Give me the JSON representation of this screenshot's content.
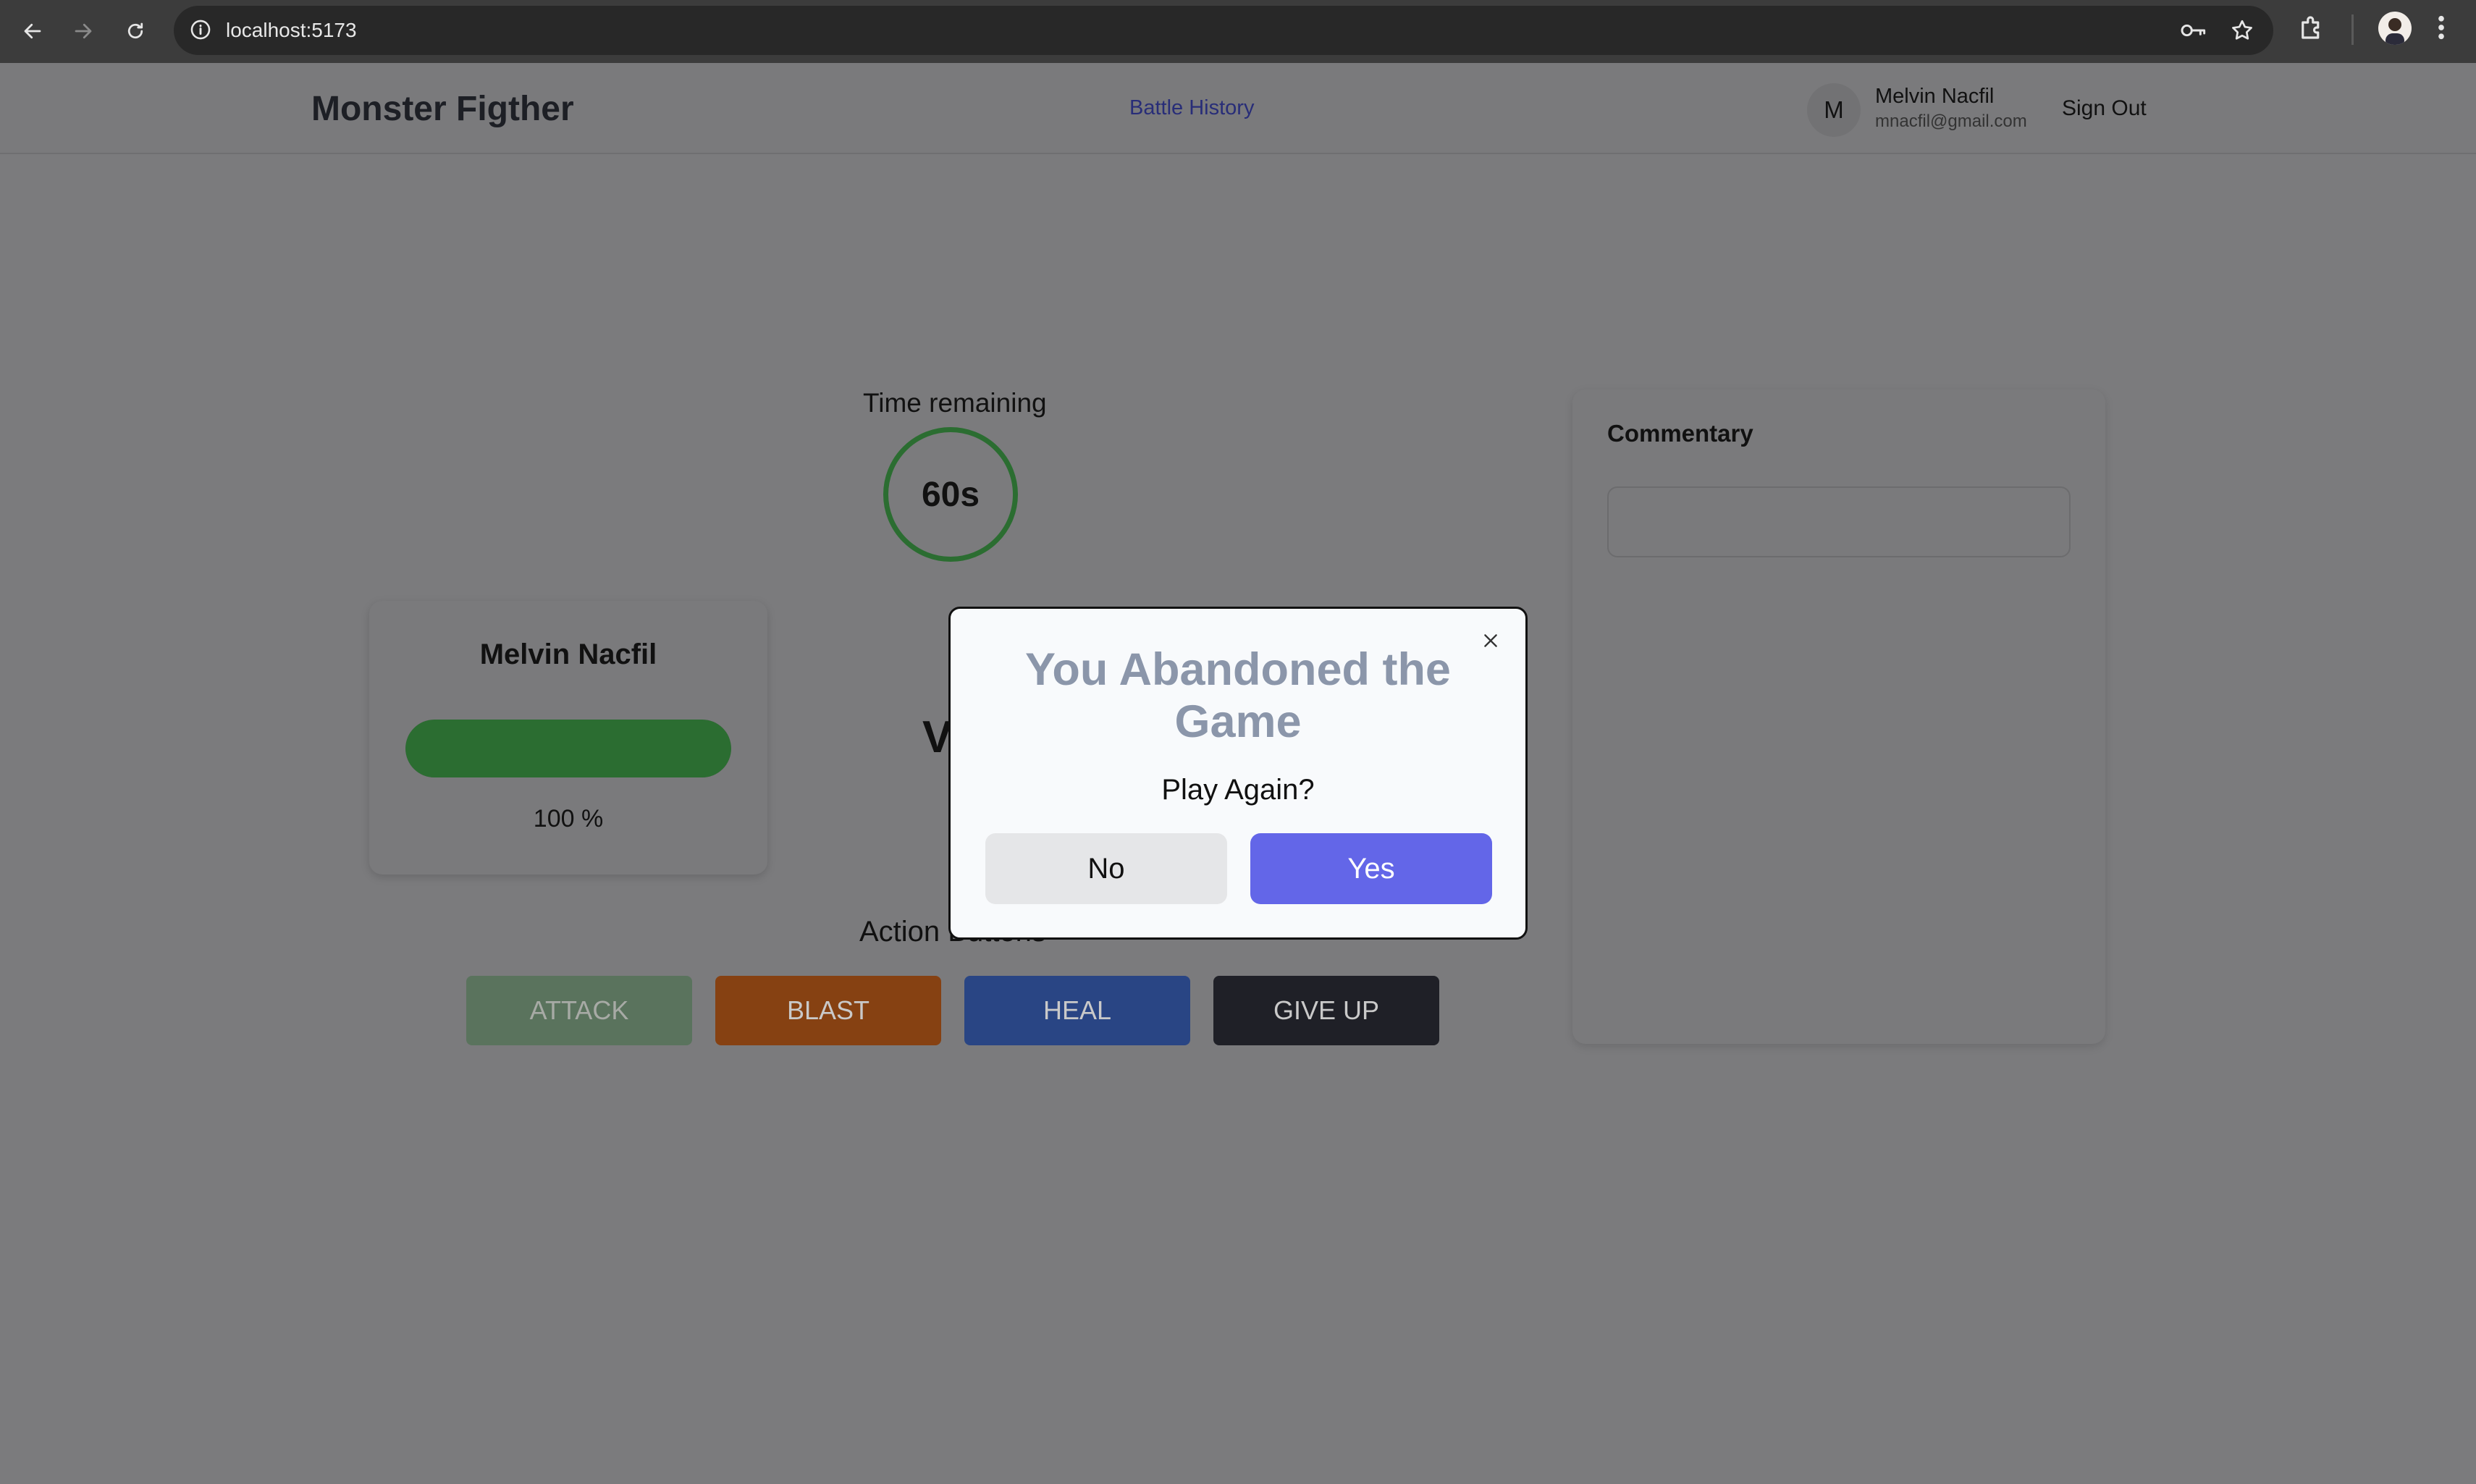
{
  "browser": {
    "url": "localhost:5173"
  },
  "header": {
    "brand": "Monster Figther",
    "nav_link": "Battle History",
    "user": {
      "initial": "M",
      "name": "Melvin Nacfil",
      "email": "mnacfil@gmail.com"
    },
    "sign_out": "Sign Out"
  },
  "game": {
    "timer_label": "Time remaining",
    "timer_value": "60s",
    "player": {
      "name": "Melvin Nacfil",
      "health_percent": 100,
      "health_text": "100 %"
    },
    "vs_text": "V",
    "actions_label": "Action Buttons",
    "actions": {
      "attack": "ATTACK",
      "blast": "BLAST",
      "heal": "HEAL",
      "give_up": "GIVE UP"
    },
    "commentary_title": "Commentary"
  },
  "modal": {
    "title": "You Abandoned the Game",
    "question": "Play Again?",
    "no_label": "No",
    "yes_label": "Yes"
  },
  "colors": {
    "health": "#2b6d31",
    "yes_button": "#6366e8",
    "blast": "#864112",
    "heal": "#294584",
    "give_up": "#1f2027"
  }
}
